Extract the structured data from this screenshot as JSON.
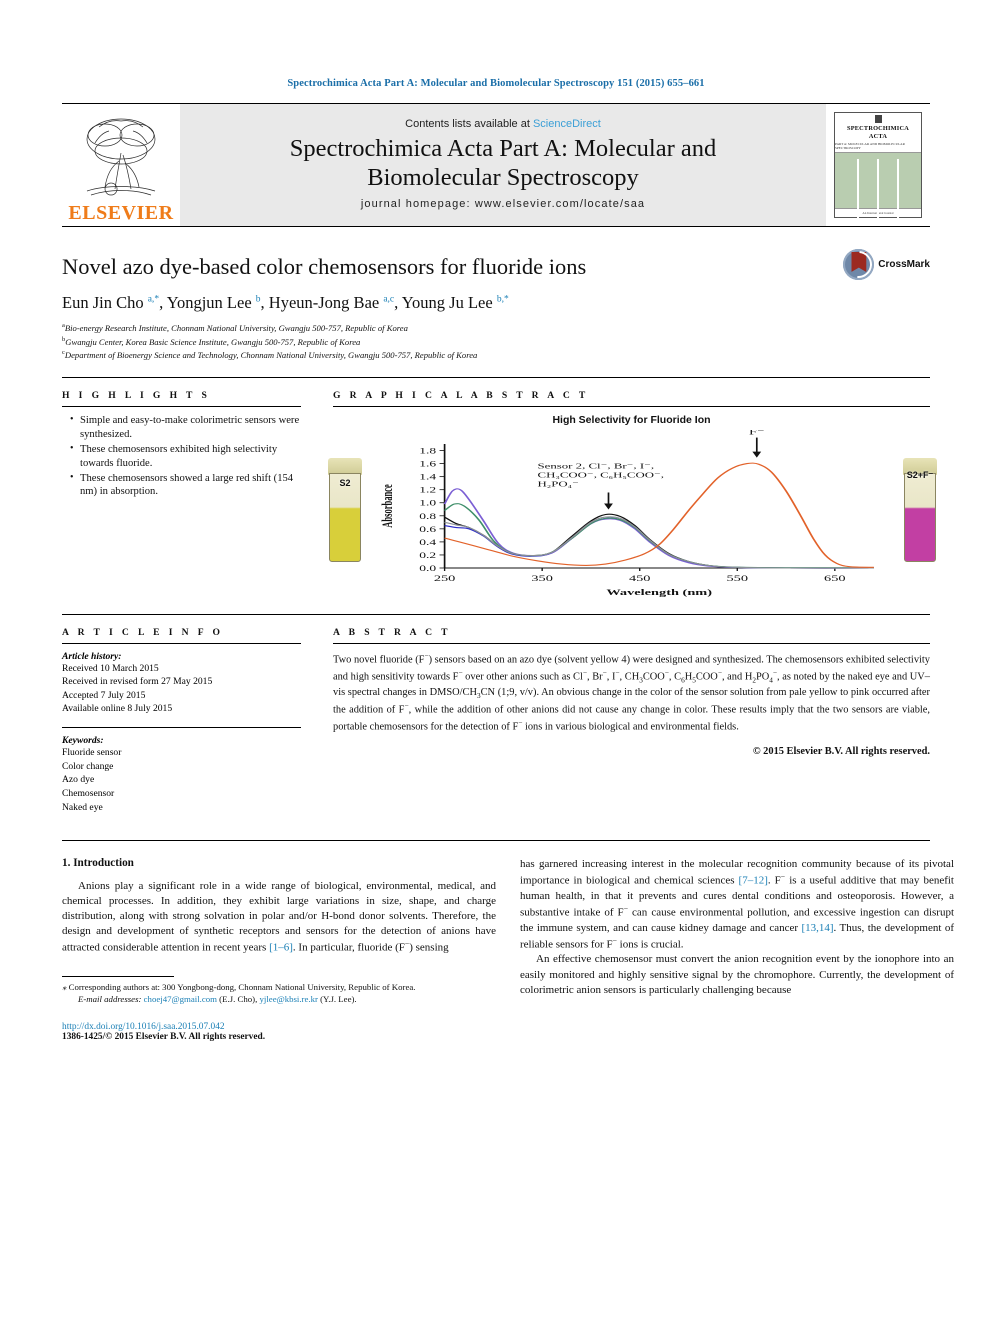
{
  "running_head": "Spectrochimica Acta Part A: Molecular and Biomolecular Spectroscopy 151 (2015) 655–661",
  "masthead": {
    "contents_prefix": "Contents lists available at ",
    "sciencedirect": "ScienceDirect",
    "journal_title_line1": "Spectrochimica Acta Part A: Molecular and",
    "journal_title_line2": "Biomolecular Spectroscopy",
    "homepage": "journal homepage: www.elsevier.com/locate/saa",
    "publisher": "ELSEVIER",
    "cover_title_line1": "SPECTROCHIMICA",
    "cover_title_line2": "ACTA",
    "cover_subtitle": "PART A: MOLECULAR AND BIOMOLECULAR SPECTROSCOPY",
    "cover_footer": "An International Journal"
  },
  "article": {
    "title": "Novel azo dye-based color chemosensors for fluoride ions",
    "crossmark_label": "CrossMark",
    "authors_html": "Eun Jin Cho <sup>a,</sup><sup>*</sup>, Yongjun Lee <sup>b</sup>, Hyeun-Jong Bae <sup>a,c</sup>, Young Ju Lee <sup>b,</sup><sup>*</sup>",
    "affiliations": [
      "Bio-energy Research Institute, Chonnam National University, Gwangju 500-757, Republic of Korea",
      "Gwangju Center, Korea Basic Science Institute, Gwangju 500-757, Republic of Korea",
      "Department of Bioenergy Science and Technology, Chonnam National University, Gwangju 500-757, Republic of Korea"
    ],
    "affil_marks": [
      "a",
      "b",
      "c"
    ]
  },
  "highlights": {
    "heading": "H I G H L I G H T S",
    "items": [
      "Simple and easy-to-make colorimetric sensors were synthesized.",
      "These chemosensors exhibited high selectivity towards fluoride.",
      "These chemosensors showed a large red shift (154 nm) in absorption."
    ]
  },
  "graphical_abstract": {
    "heading": "G R A P H I C A L   A B S T R A C T",
    "vial_left_label": "S2",
    "vial_right_label": "S2+F⁻"
  },
  "chart_data": {
    "type": "line",
    "title": "High Selectivity for Fluoride Ion",
    "xlabel": "Wavelength (nm)",
    "ylabel": "Absorbance",
    "xlim": [
      250,
      690
    ],
    "ylim": [
      0.0,
      1.9
    ],
    "xticks": [
      250,
      350,
      450,
      550,
      650
    ],
    "yticks": [
      "0.0",
      "0.2",
      "0.4",
      "0.6",
      "0.8",
      "1.0",
      "1.2",
      "1.4",
      "1.6",
      "1.8"
    ],
    "annotations": [
      {
        "text": "F⁻",
        "target_x": 570,
        "target_y": 1.6
      },
      {
        "text": "Sensor 2, Cl⁻, Br⁻, I⁻, CH₃COO⁻, C₆H₅COO⁻, H₂PO₄⁻",
        "target_x": 418,
        "target_y": 0.82
      }
    ],
    "annotation_lines": [
      "Sensor 2, Cl⁻, Br⁻, I⁻,",
      "CH₃COO⁻, C₆H₅COO⁻,",
      "H₂PO₄⁻"
    ],
    "series": [
      {
        "name": "Sensor 2 (black)",
        "color": "#111111",
        "points": [
          [
            250,
            0.78
          ],
          [
            262,
            0.68
          ],
          [
            275,
            0.62
          ],
          [
            290,
            0.5
          ],
          [
            305,
            0.33
          ],
          [
            320,
            0.22
          ],
          [
            340,
            0.19
          ],
          [
            360,
            0.24
          ],
          [
            380,
            0.48
          ],
          [
            400,
            0.72
          ],
          [
            415,
            0.82
          ],
          [
            430,
            0.79
          ],
          [
            445,
            0.65
          ],
          [
            460,
            0.44
          ],
          [
            480,
            0.22
          ],
          [
            500,
            0.1
          ],
          [
            520,
            0.04
          ],
          [
            545,
            0.01
          ],
          [
            600,
            0.0
          ],
          [
            690,
            0.0
          ]
        ]
      },
      {
        "name": "Cl⁻ (blue)",
        "color": "#2b2bc8",
        "points": [
          [
            250,
            0.65
          ],
          [
            262,
            0.62
          ],
          [
            275,
            0.6
          ],
          [
            290,
            0.49
          ],
          [
            305,
            0.32
          ],
          [
            320,
            0.21
          ],
          [
            340,
            0.18
          ],
          [
            360,
            0.23
          ],
          [
            380,
            0.45
          ],
          [
            400,
            0.68
          ],
          [
            415,
            0.76
          ],
          [
            430,
            0.74
          ],
          [
            445,
            0.61
          ],
          [
            460,
            0.41
          ],
          [
            480,
            0.2
          ],
          [
            500,
            0.09
          ],
          [
            520,
            0.035
          ],
          [
            545,
            0.01
          ],
          [
            600,
            0.0
          ],
          [
            690,
            0.0
          ]
        ]
      },
      {
        "name": "Br⁻ (purple)",
        "color": "#7b5fd4",
        "points": [
          [
            250,
            0.98
          ],
          [
            258,
            1.18
          ],
          [
            266,
            1.2
          ],
          [
            275,
            1.05
          ],
          [
            290,
            0.72
          ],
          [
            305,
            0.38
          ],
          [
            320,
            0.23
          ],
          [
            340,
            0.19
          ],
          [
            360,
            0.23
          ],
          [
            380,
            0.45
          ],
          [
            400,
            0.68
          ],
          [
            415,
            0.75
          ],
          [
            430,
            0.73
          ],
          [
            445,
            0.6
          ],
          [
            460,
            0.4
          ],
          [
            480,
            0.19
          ],
          [
            500,
            0.08
          ],
          [
            520,
            0.03
          ],
          [
            545,
            0.01
          ],
          [
            600,
            0.0
          ],
          [
            690,
            0.0
          ]
        ]
      },
      {
        "name": "I⁻ (green)",
        "color": "#3f8f6a",
        "points": [
          [
            250,
            0.88
          ],
          [
            260,
            0.98
          ],
          [
            270,
            0.95
          ],
          [
            285,
            0.74
          ],
          [
            300,
            0.42
          ],
          [
            315,
            0.25
          ],
          [
            335,
            0.19
          ],
          [
            358,
            0.23
          ],
          [
            380,
            0.45
          ],
          [
            400,
            0.68
          ],
          [
            415,
            0.76
          ],
          [
            430,
            0.74
          ],
          [
            445,
            0.62
          ],
          [
            460,
            0.42
          ],
          [
            480,
            0.21
          ],
          [
            500,
            0.1
          ],
          [
            520,
            0.04
          ],
          [
            545,
            0.015
          ],
          [
            600,
            0.005
          ],
          [
            690,
            0.005
          ]
        ]
      },
      {
        "name": "CH₃COO⁻ (grey)",
        "color": "#8a8f95",
        "points": [
          [
            250,
            0.7
          ],
          [
            262,
            0.66
          ],
          [
            275,
            0.62
          ],
          [
            290,
            0.5
          ],
          [
            305,
            0.33
          ],
          [
            320,
            0.22
          ],
          [
            340,
            0.19
          ],
          [
            360,
            0.24
          ],
          [
            380,
            0.46
          ],
          [
            400,
            0.7
          ],
          [
            415,
            0.78
          ],
          [
            430,
            0.76
          ],
          [
            445,
            0.63
          ],
          [
            460,
            0.43
          ],
          [
            480,
            0.21
          ],
          [
            500,
            0.1
          ],
          [
            520,
            0.04
          ],
          [
            545,
            0.012
          ],
          [
            600,
            0.0
          ],
          [
            690,
            0.0
          ]
        ]
      },
      {
        "name": "F⁻ (orange)",
        "color": "#e2622a",
        "points": [
          [
            250,
            0.46
          ],
          [
            265,
            0.4
          ],
          [
            280,
            0.34
          ],
          [
            300,
            0.26
          ],
          [
            320,
            0.18
          ],
          [
            345,
            0.11
          ],
          [
            370,
            0.06
          ],
          [
            395,
            0.04
          ],
          [
            415,
            0.06
          ],
          [
            435,
            0.12
          ],
          [
            455,
            0.22
          ],
          [
            470,
            0.36
          ],
          [
            485,
            0.6
          ],
          [
            500,
            0.88
          ],
          [
            515,
            1.14
          ],
          [
            530,
            1.38
          ],
          [
            545,
            1.53
          ],
          [
            560,
            1.6
          ],
          [
            572,
            1.59
          ],
          [
            585,
            1.47
          ],
          [
            600,
            1.18
          ],
          [
            615,
            0.8
          ],
          [
            628,
            0.45
          ],
          [
            640,
            0.2
          ],
          [
            652,
            0.07
          ],
          [
            665,
            0.02
          ],
          [
            690,
            0.01
          ]
        ]
      }
    ]
  },
  "article_info": {
    "heading": "A R T I C L E   I N F O",
    "history_label": "Article history:",
    "history": [
      "Received 10 March 2015",
      "Received in revised form 27 May 2015",
      "Accepted 7 July 2015",
      "Available online 8 July 2015"
    ],
    "keywords_label": "Keywords:",
    "keywords": [
      "Fluoride sensor",
      "Color change",
      "Azo dye",
      "Chemosensor",
      "Naked eye"
    ]
  },
  "abstract": {
    "heading": "A B S T R A C T",
    "text_html": "Two novel fluoride (F<sup>−</sup>) sensors based on an azo dye (solvent yellow 4) were designed and synthesized. The chemosensors exhibited selectivity and high sensitivity towards F<sup>−</sup> over other anions such as Cl<sup>−</sup>, Br<sup>−</sup>, I<sup>−</sup>, CH<sub>3</sub>COO<sup>−</sup>, C<sub>6</sub>H<sub>5</sub>COO<sup>−</sup>, and H<sub>2</sub>PO<sub>4</sub><sup>−</sup>, as noted by the naked eye and UV–vis spectral changes in DMSO/CH<sub>3</sub>CN (1;9, v/v). An obvious change in the color of the sensor solution from pale yellow to pink occurred after the addition of F<sup>−</sup>, while the addition of other anions did not cause any change in color. These results imply that the two sensors are viable, portable chemosensors for the detection of F<sup>−</sup> ions in various biological and environmental fields.",
    "copyright": "© 2015 Elsevier B.V. All rights reserved."
  },
  "body": {
    "section_title": "1. Introduction",
    "left_para1_html": "Anions play a significant role in a wide range of biological, environmental, medical, and chemical processes. In addition, they exhibit large variations in size, shape, and charge distribution, along with strong solvation in polar and/or H-bond donor solvents. Therefore, the design and development of synthetic receptors and sensors for the detection of anions have attracted considerable attention in recent years <span class=\"ref\">[1–6]</span>. In particular, fluoride (F<sup>−</sup>) sensing",
    "right_para1_html": "has garnered increasing interest in the molecular recognition community because of its pivotal importance in biological and chemical sciences <span class=\"ref\">[7–12]</span>. F<sup>−</sup> is a useful additive that may benefit human health, in that it prevents and cures dental conditions and osteoporosis. However, a substantive intake of F<sup>−</sup> can cause environmental pollution, and excessive ingestion can disrupt the immune system, and can cause kidney damage and cancer <span class=\"ref\">[13,14]</span>. Thus, the development of reliable sensors for F<sup>−</sup> ions is crucial.",
    "right_para2_html": "An effective chemosensor must convert the anion recognition event by the ionophore into an easily monitored and highly sensitive signal by the chromophore. Currently, the development of colorimetric anion sensors is particularly challenging because"
  },
  "footer": {
    "corresponding_html": "<span class=\"it\">⁎</span> Corresponding authors at: 300 Yongbong-dong, Chonnam National University, Republic of Korea.",
    "email_html": "<span class=\"it\">E-mail addresses:</span> <span class=\"link\">choej47@gmail.com</span> (E.J. Cho), <span class=\"link\">yjlee@kbsi.re.kr</span> (Y.J. Lee).",
    "doi": "http://dx.doi.org/10.1016/j.saa.2015.07.042",
    "issn": "1386-1425/© 2015 Elsevier B.V. All rights reserved."
  }
}
